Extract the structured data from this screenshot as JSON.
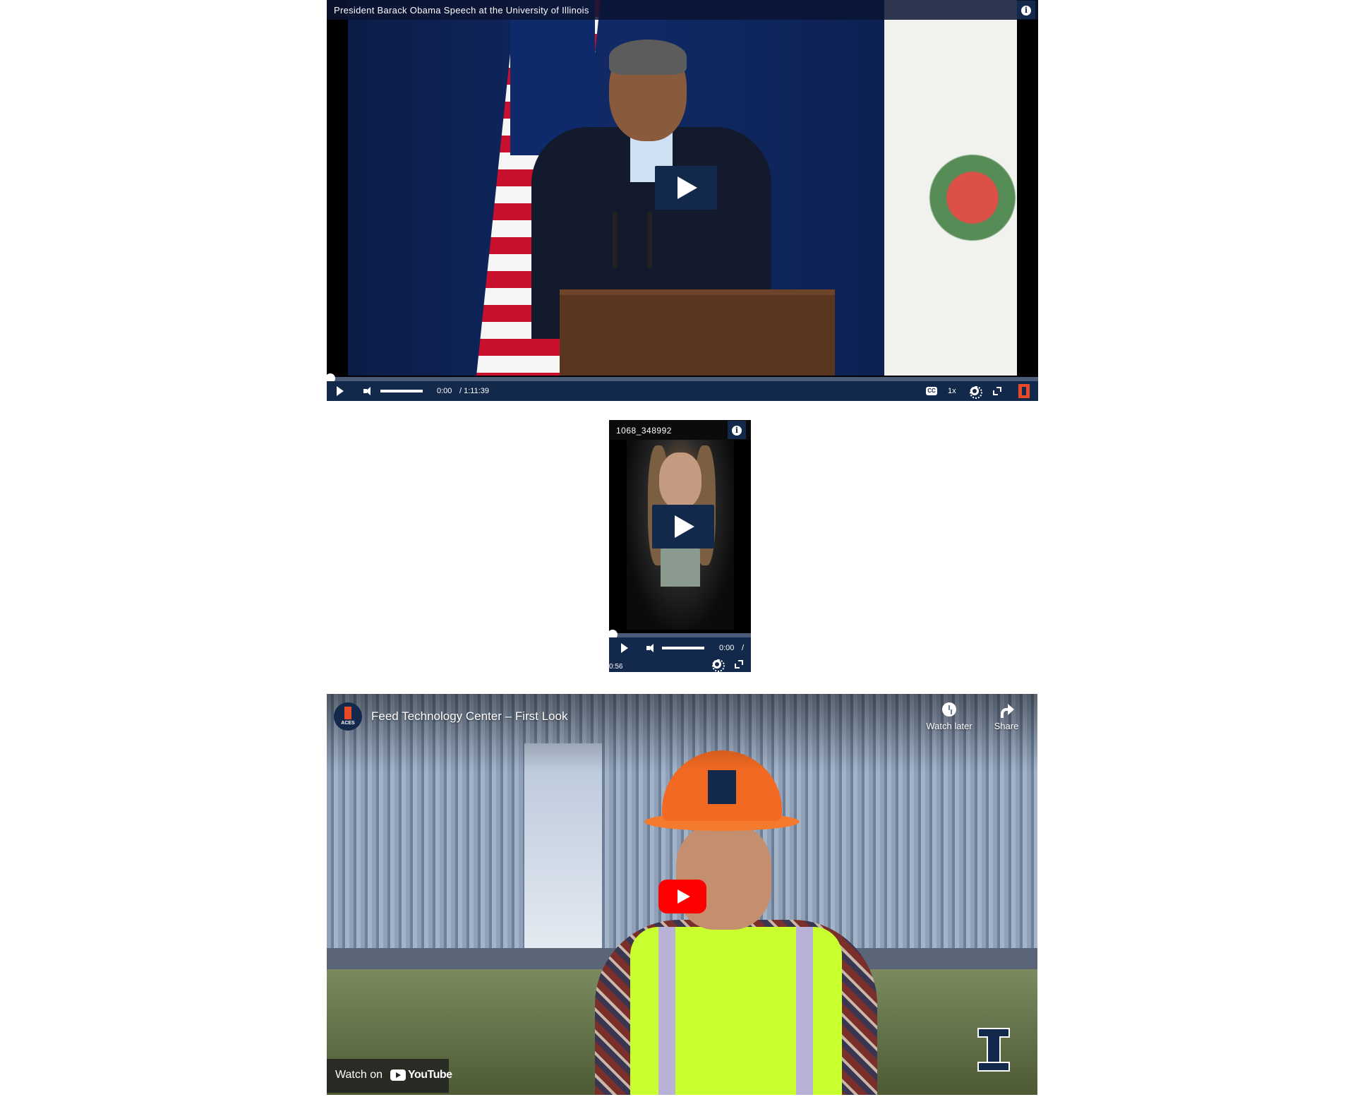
{
  "player1": {
    "title": "President Barack Obama Speech at the University of Illinois",
    "info_label": "i",
    "progress": 0,
    "time_current": "0:00",
    "time_total": "/ 1:11:39",
    "cc_label": "CC",
    "speed": "1x"
  },
  "player2": {
    "title": "1068_348992",
    "info_label": "i",
    "progress": 0,
    "time_current": "0:00",
    "time_sep": "/",
    "time_total": "0:56"
  },
  "youtube": {
    "channel_badge": "ACES",
    "title": "Feed Technology Center – First Look",
    "watch_later": "Watch later",
    "share": "Share",
    "watch_on": "Watch on",
    "youtube_label": "YouTube"
  },
  "colors": {
    "illini_blue": "#13294b",
    "illini_orange": "#e84a27",
    "youtube_red": "#ff0000"
  }
}
